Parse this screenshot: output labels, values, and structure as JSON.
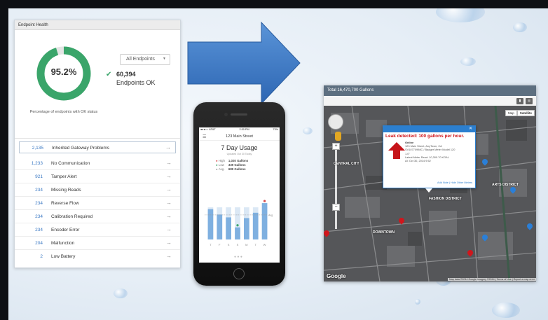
{
  "endpoint_health": {
    "title": "Endpoint Health",
    "ok_percent_label": "95.2%",
    "ok_fraction": 0.952,
    "caption": "Percentage of endpoints with OK status",
    "filter": "All Endpoints",
    "ok_count": "60,394",
    "ok_label": "Endpoints OK",
    "issues": [
      {
        "count": "2,135",
        "label": "Inherited Gateway Problems"
      },
      {
        "count": "1,233",
        "label": "No Communication"
      },
      {
        "count": "921",
        "label": "Tamper Alert"
      },
      {
        "count": "234",
        "label": "Missing Reads"
      },
      {
        "count": "234",
        "label": "Reverse Flow"
      },
      {
        "count": "234",
        "label": "Calibration Required"
      },
      {
        "count": "234",
        "label": "Encoder Error"
      },
      {
        "count": "204",
        "label": "Malfunction"
      },
      {
        "count": "2",
        "label": "Low Battery"
      }
    ],
    "colors": {
      "ok": "#3aa56a",
      "track": "#e5e5e5",
      "link": "#3a78c3"
    }
  },
  "phone": {
    "carrier": "●●●○○ AT&T",
    "time": "2:30 PM",
    "battery": "73%",
    "nav_title": "123 Main Street",
    "title": "7 Day Usage",
    "subtitle": "Updated Oct 30 Today",
    "legend": [
      {
        "key": "High",
        "value": "1,020 Gallons",
        "color": "#d84a4a"
      },
      {
        "key": "Low",
        "value": "339 Gallons",
        "color": "#3aa56a"
      },
      {
        "key": "Avg.",
        "value": "689 Gallons",
        "color": "#999999"
      }
    ],
    "avg_label": "Avg",
    "chart_data": {
      "type": "bar",
      "categories": [
        "T",
        "F",
        "S",
        "S",
        "M",
        "T",
        "W"
      ],
      "values": [
        850,
        700,
        620,
        339,
        600,
        750,
        1020
      ],
      "avg": 689
    }
  },
  "map": {
    "title": "Total 16,470,700 Gallons",
    "map_type": [
      "Map",
      "Satellite"
    ],
    "popup": {
      "title": "Leak detected: 100 gallons per hour.",
      "status": "Online",
      "address": "123 Main Street, AnyTown, CA",
      "meter": "SV10770998C / Badger Meter Model 120",
      "size": "1.0\"",
      "last_read": "Latest Meter Read: 10,300.70 KGAL",
      "read_time": "At: Oct 30, 2014 9:52",
      "links": "Add Note | Hide Other Meters"
    },
    "labels": [
      "CENTRAL CITY",
      "FASHION DISTRICT",
      "DOWNTOWN",
      "ARTS DISTRICT"
    ],
    "google": "Google",
    "terms": "Map data ©2014 Google Imagery ©2014 | Terms of Use | Report a map error"
  }
}
